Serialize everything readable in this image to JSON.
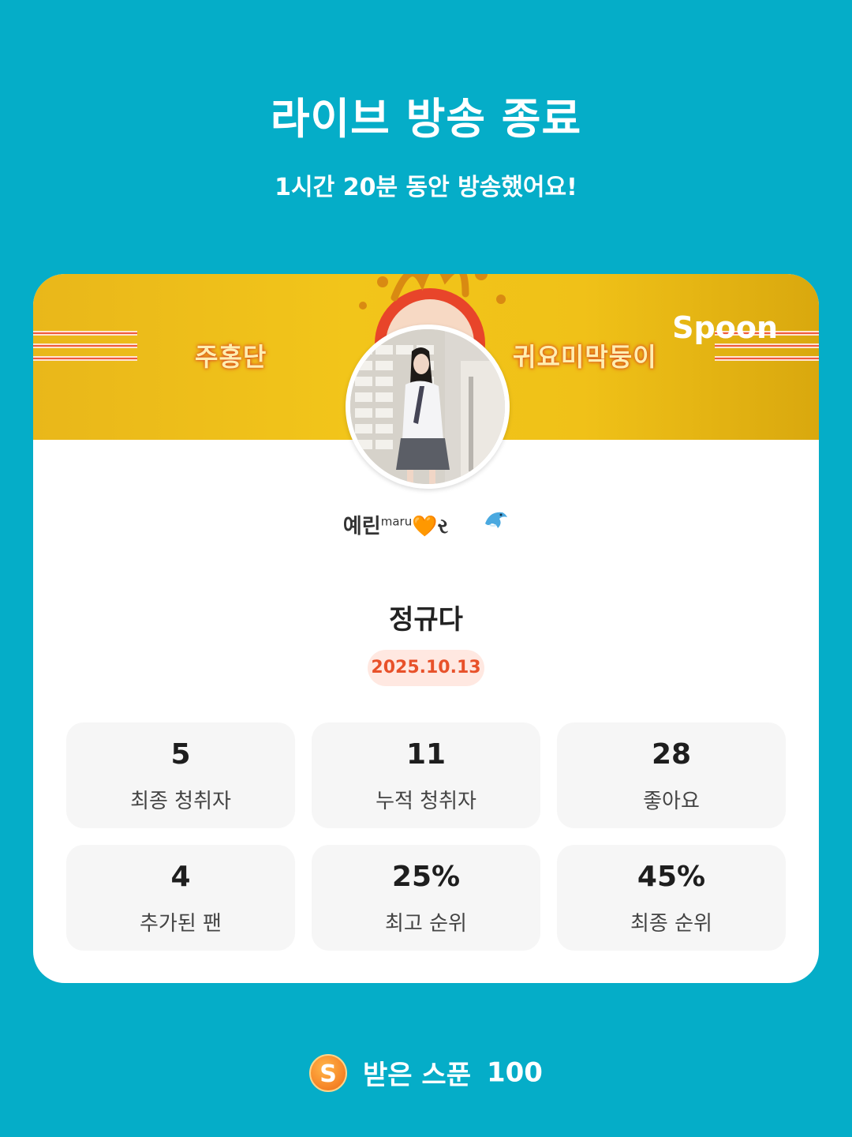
{
  "header": {
    "title": "라이브 방송 종료",
    "subtitle": "1시간 20분 동안 방송했어요!"
  },
  "card": {
    "banner": {
      "left_text": "주홍단",
      "right_text": "귀요미막둥이",
      "brand": "Spoon"
    },
    "nickname": "예린",
    "nickname_sup": "maru",
    "nickname_suffix": "🧡ર",
    "badge_icon": "dolphin-icon",
    "broadcast_title": "정규다",
    "date": "2025.10.13",
    "stats": [
      {
        "value": "5",
        "label": "최종 청취자"
      },
      {
        "value": "11",
        "label": "누적 청취자"
      },
      {
        "value": "28",
        "label": "좋아요"
      },
      {
        "value": "4",
        "label": "추가된 팬"
      },
      {
        "value": "25%",
        "label": "최고 순위"
      },
      {
        "value": "45%",
        "label": "최종 순위"
      }
    ]
  },
  "footer": {
    "coin_letter": "S",
    "label": "받은 스푼",
    "value": "100"
  },
  "colors": {
    "background": "#05adc8",
    "banner": "#f2c51a",
    "date_text": "#e8512a",
    "date_bg": "#ffe8e1",
    "coin": "#f7892a"
  }
}
